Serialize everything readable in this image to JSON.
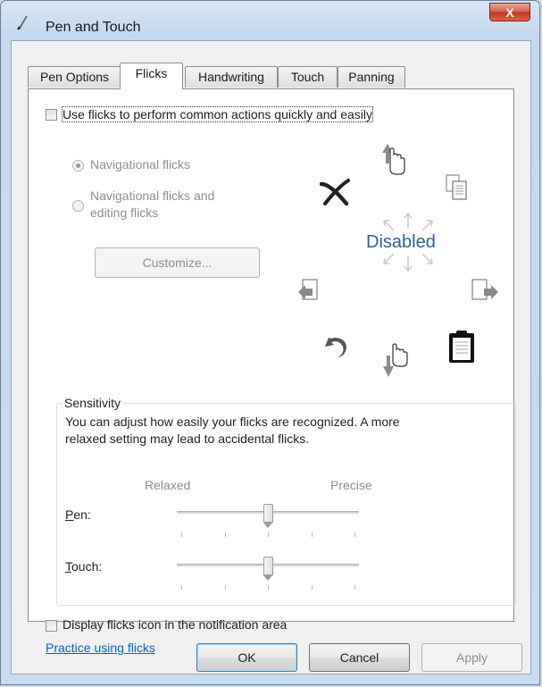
{
  "window": {
    "title": "Pen and Touch",
    "close_label": "X"
  },
  "tabs": [
    {
      "label": "Pen Options"
    },
    {
      "label": "Flicks"
    },
    {
      "label": "Handwriting"
    },
    {
      "label": "Touch"
    },
    {
      "label": "Panning"
    }
  ],
  "flicks": {
    "enable_label": "Use flicks to perform common actions quickly and easily",
    "enable_checked": false,
    "radio_navigational": "Navigational flicks",
    "radio_editing_line1": "Navigational flicks and",
    "radio_editing_line2": "editing flicks",
    "customize_label": "Customize...",
    "status_text": "Disabled",
    "sensitivity": {
      "title": "Sensitivity",
      "description_line1": "You can adjust how easily your flicks are recognized. A more",
      "description_line2": "relaxed setting may lead to accidental flicks.",
      "relaxed_label": "Relaxed",
      "precise_label": "Precise",
      "pen_label": "Pen:",
      "touch_label": "Touch:",
      "pen_level": 0.5,
      "touch_level": 0.5
    },
    "notify_label": "Display flicks icon in the notification area",
    "notify_checked": false,
    "practice_link": "Practice using flicks"
  },
  "footer": {
    "ok": "OK",
    "cancel": "Cancel",
    "apply": "Apply"
  },
  "icons": [
    "pen-icon",
    "hand-up-icon",
    "copy-icon",
    "paste-icon",
    "hand-down-icon",
    "undo-icon",
    "delete-icon",
    "back-icon",
    "forward-icon"
  ]
}
